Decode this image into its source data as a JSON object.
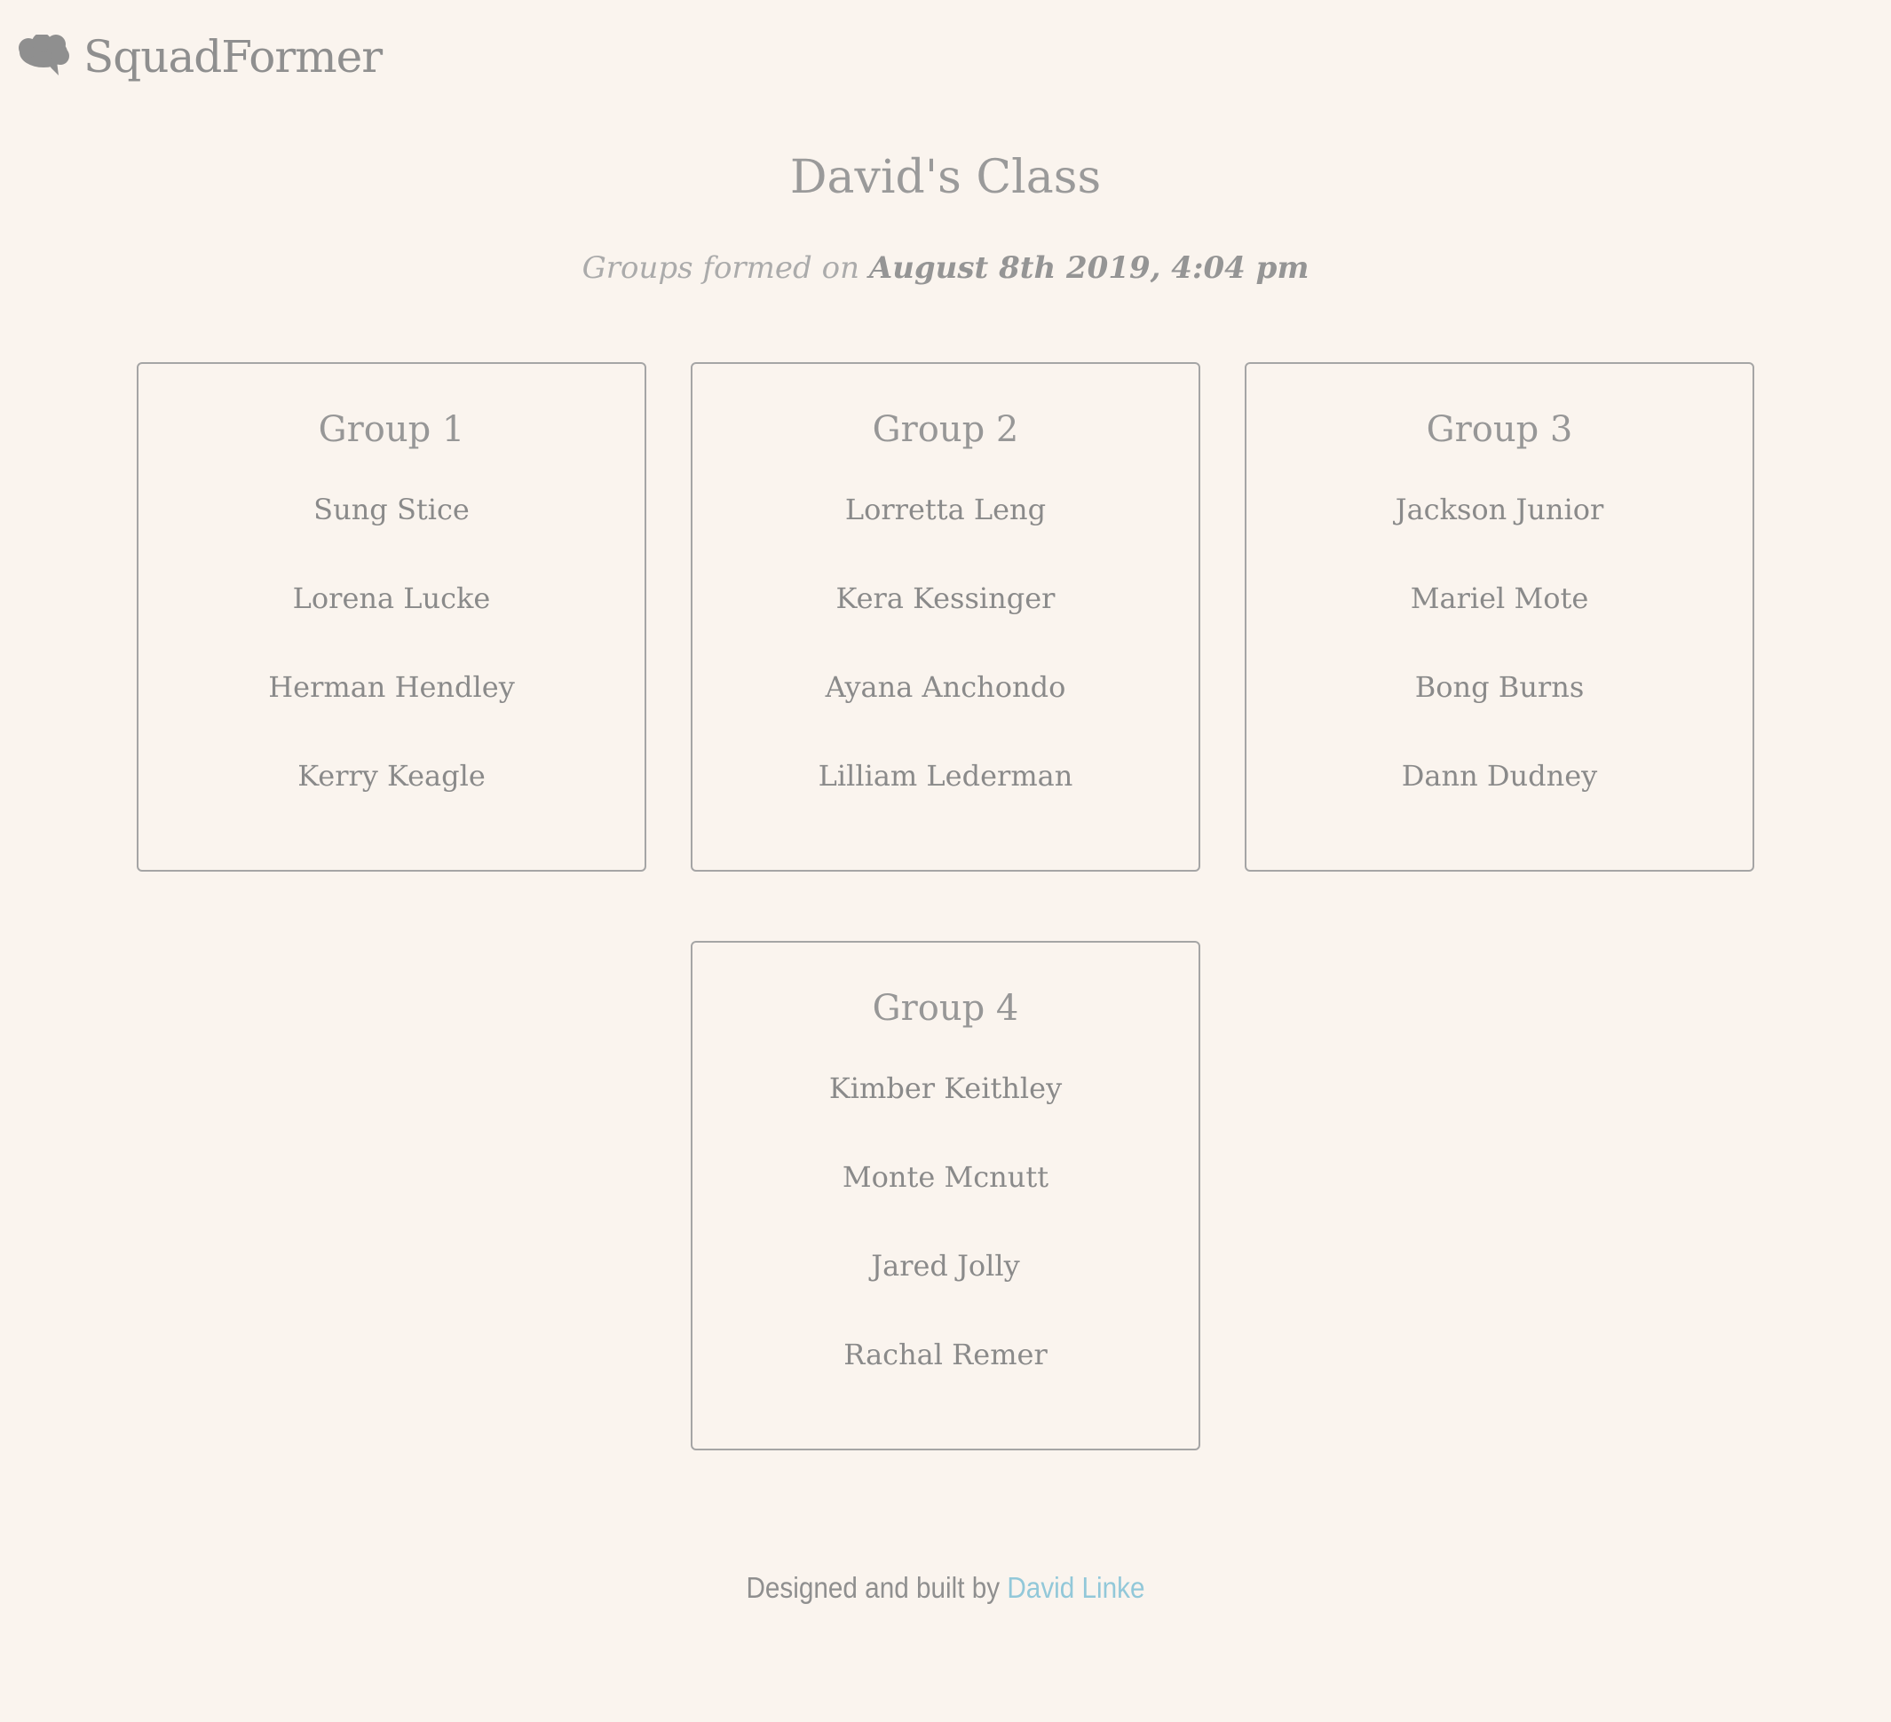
{
  "brand": {
    "name": "SquadFormer",
    "icon": "brain-icon"
  },
  "header": {
    "title": "David's Class",
    "subtitle_prefix": "Groups formed on",
    "subtitle_date": "August 8th 2019, 4:04 pm"
  },
  "groups": [
    {
      "title": "Group 1",
      "members": [
        "Sung Stice",
        "Lorena Lucke",
        "Herman Hendley",
        "Kerry Keagle"
      ]
    },
    {
      "title": "Group 2",
      "members": [
        "Lorretta Leng",
        "Kera Kessinger",
        "Ayana Anchondo",
        "Lilliam Lederman"
      ]
    },
    {
      "title": "Group 3",
      "members": [
        "Jackson Junior",
        "Mariel Mote",
        "Bong Burns",
        "Dann Dudney"
      ]
    },
    {
      "title": "Group 4",
      "members": [
        "Kimber Keithley",
        "Monte Mcnutt",
        "Jared Jolly",
        "Rachal Remer"
      ]
    }
  ],
  "footer": {
    "text": "Designed and built by",
    "link_label": "David Linke"
  },
  "colors": {
    "background": "#faf4ee",
    "text": "#8e8e8e",
    "link": "#92c8d9",
    "card_border": "#a5a5a5"
  }
}
